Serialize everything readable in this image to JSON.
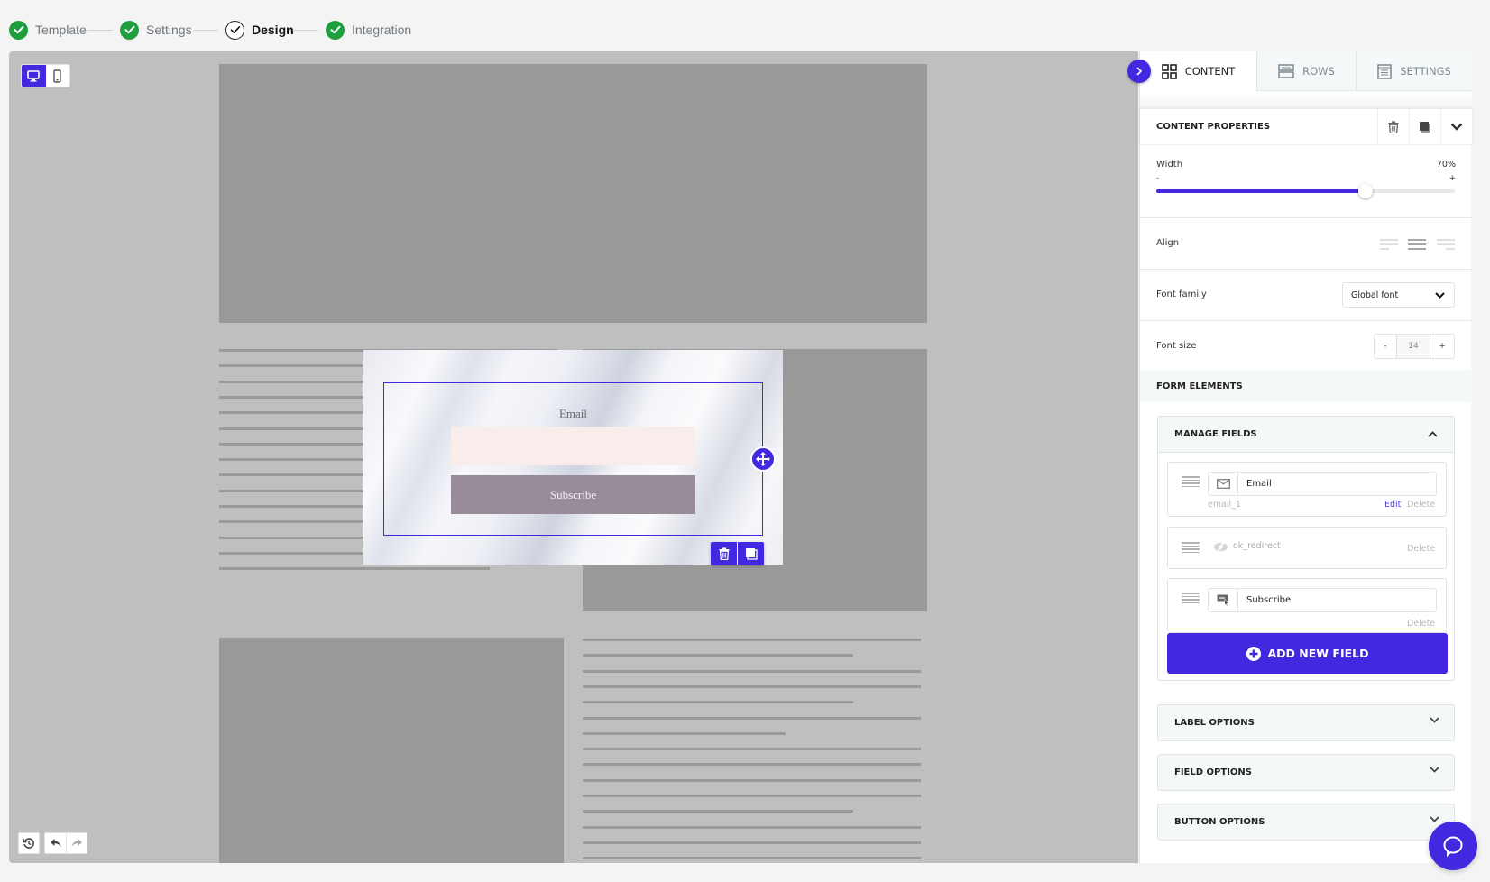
{
  "stepper": {
    "steps": [
      {
        "label": "Template",
        "state": "done"
      },
      {
        "label": "Settings",
        "state": "done"
      },
      {
        "label": "Design",
        "state": "current"
      },
      {
        "label": "Integration",
        "state": "done"
      }
    ]
  },
  "canvas": {
    "device_toggle": {
      "desktop": "desktop-icon",
      "mobile": "mobile-icon",
      "active": "desktop"
    },
    "history_controls": [
      "history-icon",
      "undo-icon",
      "redo-icon"
    ],
    "form_preview": {
      "label": "Email",
      "input_value": "",
      "button_label": "Subscribe",
      "colors": {
        "input_bg": "#f8edeb",
        "button_bg": "#998c99",
        "selection": "#4229e0"
      }
    }
  },
  "panel": {
    "tabs": [
      {
        "label": "CONTENT",
        "icon": "grid-icon",
        "active": true
      },
      {
        "label": "ROWS",
        "icon": "rows-icon",
        "active": false
      },
      {
        "label": "SETTINGS",
        "icon": "settings-doc-icon",
        "active": false
      }
    ],
    "content_properties": {
      "title": "CONTENT PROPERTIES",
      "width_label": "Width",
      "width_value": "70%",
      "width_fraction": 0.7,
      "slider_min_label": "-",
      "slider_max_label": "+",
      "align_label": "Align",
      "align_selected": "center",
      "font_family_label": "Font family",
      "font_family_value": "Global font",
      "font_size_label": "Font size",
      "font_size_value": "14",
      "font_size_minus": "-",
      "font_size_plus": "+"
    },
    "form_elements": {
      "title": "FORM ELEMENTS",
      "manage_fields_title": "MANAGE FIELDS",
      "fields": [
        {
          "label": "Email",
          "name": "email_1",
          "icon": "envelope-icon",
          "edit": "Edit",
          "delete": "Delete"
        },
        {
          "label": "ok_redirect",
          "icon": "hidden-eye-icon",
          "delete": "Delete"
        },
        {
          "label": "Subscribe",
          "icon": "button-cursor-icon",
          "delete": "Delete"
        }
      ],
      "add_field_label": "ADD NEW FIELD",
      "accordions": [
        "LABEL OPTIONS",
        "FIELD OPTIONS",
        "BUTTON OPTIONS"
      ]
    }
  },
  "colors": {
    "accent": "#4229e0",
    "success": "#1f9e3e"
  }
}
